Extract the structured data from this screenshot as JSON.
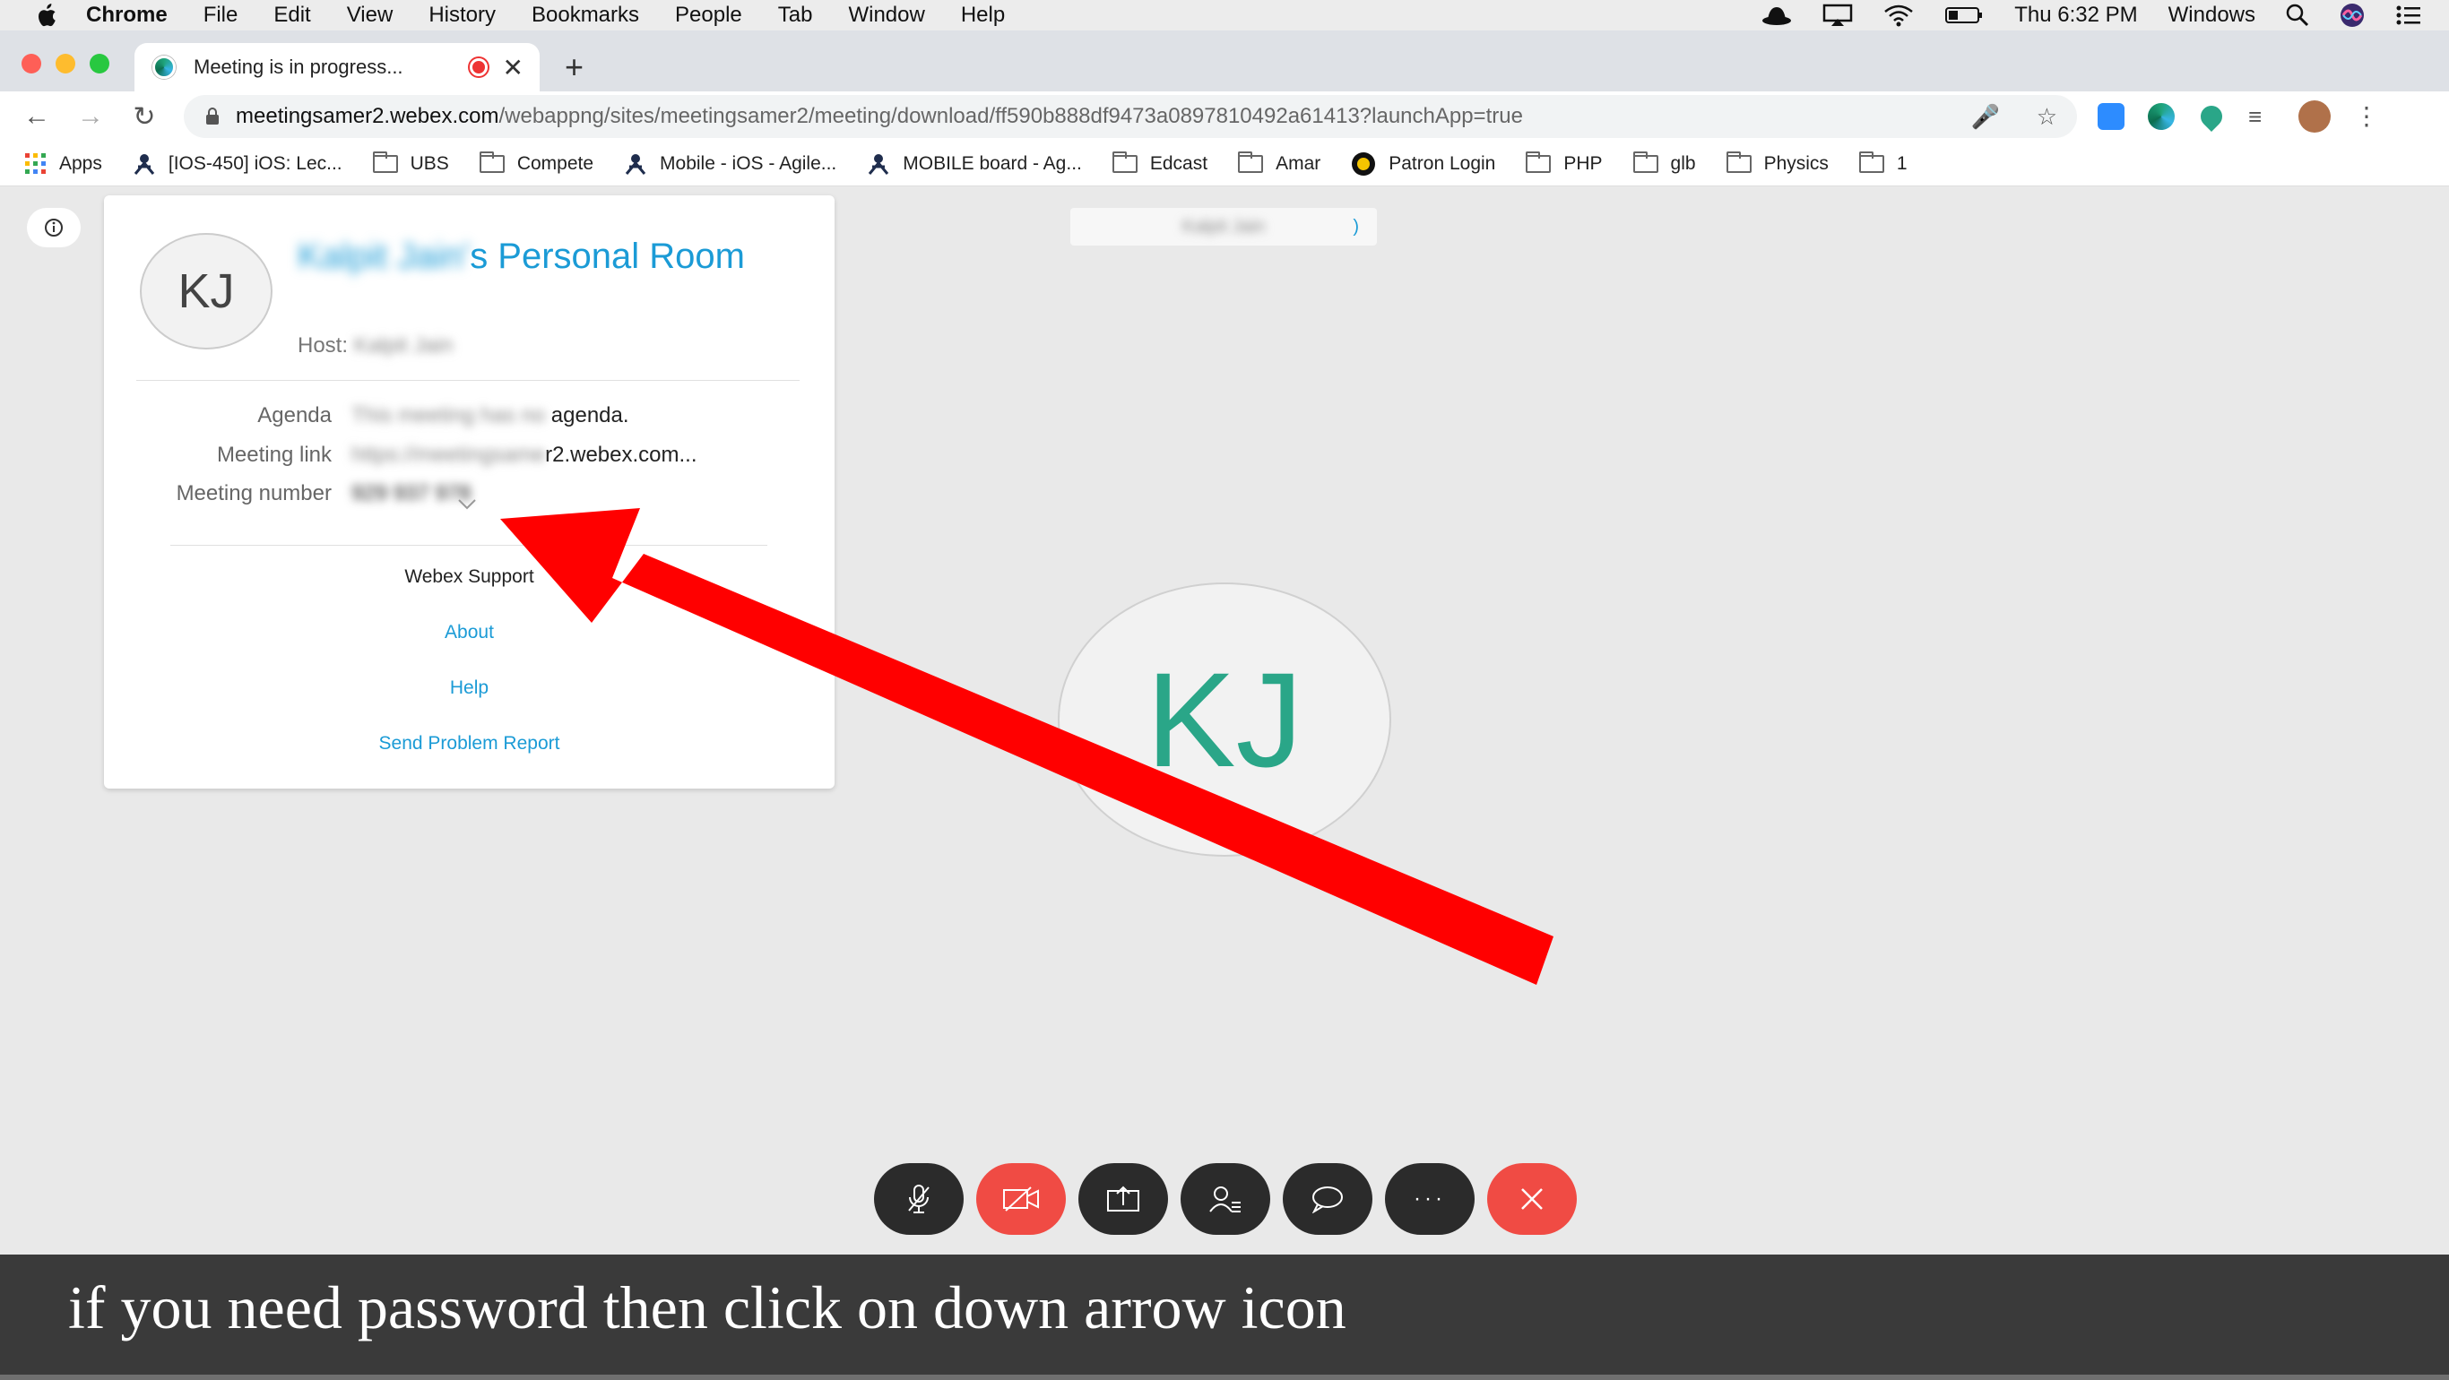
{
  "menubar": {
    "app": "Chrome",
    "items": [
      "File",
      "Edit",
      "View",
      "History",
      "Bookmarks",
      "People",
      "Tab",
      "Window",
      "Help"
    ],
    "clock": "Thu 6:32 PM",
    "windows_label": "Windows"
  },
  "tab": {
    "title": "Meeting is in progress..."
  },
  "address": {
    "host": "meetingsamer2.webex.com",
    "path": "/webappng/sites/meetingsamer2/meeting/download/ff590b888df9473a0897810492a61413?launchApp=true"
  },
  "bookmarks": [
    {
      "label": "Apps",
      "icon": "apps-grid-icon"
    },
    {
      "label": "[IOS-450] iOS: Lec...",
      "icon": "jira-icon"
    },
    {
      "label": "UBS",
      "icon": "folder-icon"
    },
    {
      "label": "Compete",
      "icon": "folder-icon"
    },
    {
      "label": "Mobile - iOS - Agile...",
      "icon": "jira-icon"
    },
    {
      "label": "MOBILE board - Ag...",
      "icon": "jira-icon"
    },
    {
      "label": "Edcast",
      "icon": "folder-icon"
    },
    {
      "label": "Amar",
      "icon": "folder-icon"
    },
    {
      "label": "Patron Login",
      "icon": "patron-icon"
    },
    {
      "label": "PHP",
      "icon": "folder-icon"
    },
    {
      "label": "glb",
      "icon": "folder-icon"
    },
    {
      "label": "Physics",
      "icon": "folder-icon"
    },
    {
      "label": "1",
      "icon": "folder-icon"
    }
  ],
  "panel": {
    "avatar_initials": "KJ",
    "title_blurred": "Kalpit Jain'",
    "title_visible": "s Personal Room",
    "host_label": "Host:",
    "host_value_blurred": "Kalpit Jain",
    "agenda_label": "Agenda",
    "agenda_blurred": "This meeting has no",
    "agenda_visible": " agenda.",
    "link_label": "Meeting link",
    "link_blurred": "https://meetingsame",
    "link_visible": "r2.webex.com...",
    "number_label": "Meeting number",
    "number_blurred": "929 937 978",
    "support_label": "Webex Support",
    "about_label": "About",
    "help_label": "Help",
    "report_label": "Send Problem Report"
  },
  "top_card": {
    "name_blurred": "Kalpit Jain",
    "edge": ")"
  },
  "video": {
    "initials": "KJ"
  },
  "controls": [
    {
      "name": "mute-button",
      "icon": "mic-off-icon",
      "glyph": "🎙"
    },
    {
      "name": "stop-video-button",
      "icon": "video-off-icon",
      "glyph": "⧄"
    },
    {
      "name": "share-button",
      "icon": "share-icon",
      "glyph": "⇪"
    },
    {
      "name": "participants-button",
      "icon": "participants-icon",
      "glyph": "👤"
    },
    {
      "name": "chat-button",
      "icon": "chat-icon",
      "glyph": "💬"
    },
    {
      "name": "more-button",
      "icon": "more-icon",
      "glyph": "···"
    },
    {
      "name": "leave-button",
      "icon": "close-icon",
      "glyph": "✕"
    }
  ],
  "caption": {
    "text": "if you need password then click on down arrow icon"
  },
  "colors": {
    "webex_blue": "#1b9bd6",
    "accent_green": "#2aa688",
    "leave_red": "#f04b44",
    "arrow_red": "#ff0000"
  }
}
